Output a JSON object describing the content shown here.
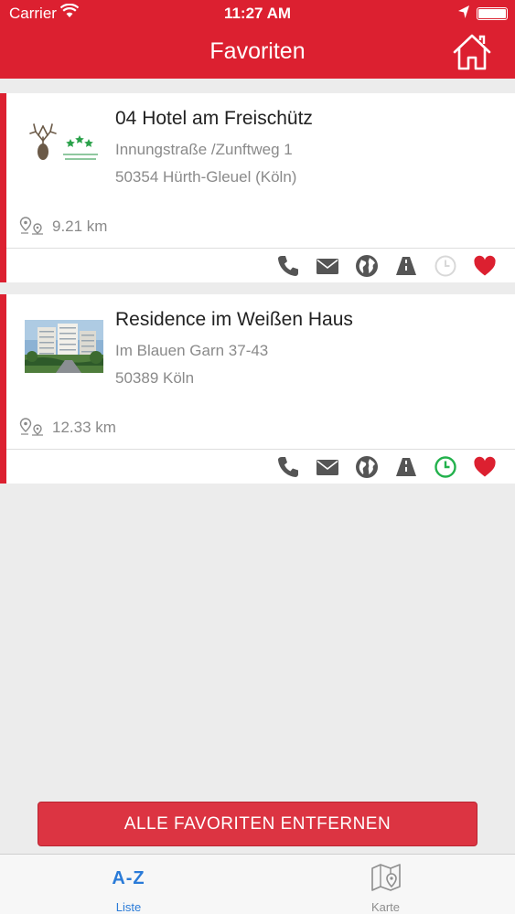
{
  "status_bar": {
    "carrier": "Carrier",
    "time": "11:27 AM"
  },
  "nav": {
    "title": "Favoriten",
    "home_icon": "home-icon"
  },
  "favorites": [
    {
      "name": "04 Hotel am Freischütz",
      "street": "Innungstraße /Zunftweg 1",
      "city": "50354 Hürth-Gleuel (Köln)",
      "distance": "9.21 km",
      "open_now": false,
      "thumbnail_icon": "hotel-logo"
    },
    {
      "name": "Residence im Weißen Haus",
      "street": "Im Blauen Garn 37-43",
      "city": "50389 Köln",
      "distance": "12.33 km",
      "open_now": true,
      "thumbnail_icon": "building-photo"
    }
  ],
  "colors": {
    "accent": "#dc2030",
    "open": "#22b14c",
    "closed": "#d8d8d8",
    "tab_active": "#2a7bd8"
  },
  "remove_button": {
    "label": "ALLE FAVORITEN ENTFERNEN"
  },
  "tabs": [
    {
      "label": "Liste",
      "glyph": "A-Z",
      "active": true
    },
    {
      "label": "Karte",
      "icon": "map-icon",
      "active": false
    }
  ]
}
